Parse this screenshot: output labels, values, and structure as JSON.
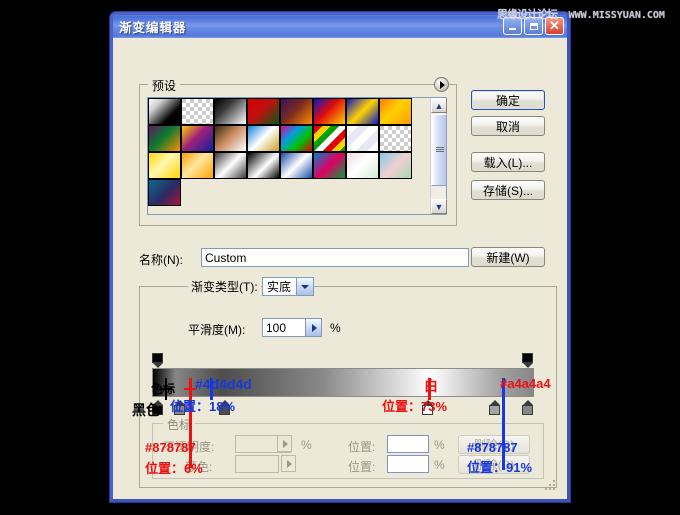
{
  "watermark": {
    "cn": "思缘设计论坛",
    "url": "WWW.MISSYUAN.COM"
  },
  "window": {
    "title": "渐变编辑器",
    "controls": {
      "minimize": "minimize-icon",
      "maximize": "maximize-icon",
      "close": "close-icon"
    }
  },
  "preset": {
    "legend": "预设",
    "arrow_icon": "preset-menu-arrow-icon",
    "scroll_up_icon": "▲",
    "scroll_down_icon": "▼",
    "swatches": [
      [
        "linear-gradient(135deg,#ffffff 0%,#cfcfcf 25%,#000000 70%)",
        "repeating-conic-gradient(#ffffff 0% 25%,#cccccc 0% 50%) 0 0/8px 8px",
        "linear-gradient(135deg,#000000 0%,#3a3a3a 35%,#ffffff 100%)",
        "linear-gradient(135deg,#d40000 0%,#c01010 45%,#0a5a14 100%)",
        "linear-gradient(135deg,#3b1060 0%,#7a2a20 45%,#ff8c00 100%)",
        "linear-gradient(135deg,#0b16c4 0%,#e00c0c 45%,#ffd000 100%)",
        "linear-gradient(135deg,#0b16c4 0%,#ffd400 50%,#0b16c4 100%)",
        "linear-gradient(135deg,#ff7a00 0%,#ffd000 45%,#ff9c00 100%)"
      ],
      [
        "linear-gradient(135deg,#6a1560 0%,#0a7a30 45%,#ff8c00 100%)",
        "linear-gradient(135deg,#ffd000 0%,#a0207a 45%,#1020a0 100%)",
        "linear-gradient(135deg,#3a2a10 0%,#c98a60 45%,#ffffff 100%)",
        "linear-gradient(135deg,#1080d8 0%,#ffffff 48%,#c8a020 100%)",
        "linear-gradient(135deg,#e000a0 0%,#00a0e0 35%,#00c000 65%,#e00000 100%)",
        "repeating-linear-gradient(135deg,#e00000 0 6px,#ffd000 6px 12px,#00a000 12px 18px,#ffffff 18px 24px)",
        "repeating-linear-gradient(135deg,#ffffff 0 8px,#e8e8f0 8px 16px)",
        "repeating-conic-gradient(#ffffff 0% 25%,#cccccc 0% 50%) 0 0/8px 8px"
      ],
      [
        "linear-gradient(135deg,#ffd800 0%,#fff7b0 45%,#ffd800 100%)",
        "linear-gradient(135deg,#ffa000 0%,#ffe8a0 45%,#ffa000 100%)",
        "linear-gradient(135deg,#3a3a3a 0%,#ffffff 50%,#3a3a3a 100%)",
        "linear-gradient(135deg,#000000 0%,#ffffff 55%,#000000 100%)",
        "linear-gradient(135deg,#1848a8 0%,#ffffff 50%,#1848a8 100%)",
        "linear-gradient(135deg,#0080d0 0%,#e00060 50%,#00a040 100%)",
        "linear-gradient(135deg,#f0d8e0 0%,#ffffff 45%,#d8ecd8 100%)",
        "linear-gradient(135deg,#80c8e8 0%,#f0d0d0 50%,#a8d8b0 100%)"
      ],
      [
        "linear-gradient(135deg,#0a6a90 0%,#2a2a60 55%,#b01040 100%)"
      ]
    ]
  },
  "buttons": {
    "ok": "确定",
    "cancel": "取消",
    "load": "载入(L)...",
    "save": "存储(S)...",
    "new": "新建(W)"
  },
  "name_field": {
    "label": "名称(N):",
    "value": "Custom"
  },
  "gradient_type": {
    "label": "渐变类型(T):",
    "value": "实底",
    "dropdown_icon": "chevron-down-icon"
  },
  "smoothness": {
    "label": "平滑度(M):",
    "value": "100",
    "unit": "%",
    "spin_icon": "spinner-arrow-icon"
  },
  "stop_controls": {
    "legend": "色标",
    "opacity_label": "不透明度:",
    "opacity_value": "",
    "opacity_unit": "%",
    "opacity_spin_icon": "spinner-arrow-icon",
    "position_label_1": "位置:",
    "position_value_1": "",
    "position_unit_1": "%",
    "delete_label_1": "删除(D)",
    "color_label": "颜色:",
    "color_value": "",
    "color_spin_icon": "spinner-arrow-icon",
    "position_label_2": "位置:",
    "position_value_2": "",
    "position_unit_2": "%",
    "delete_label_2": "删除(D)"
  },
  "gradient": {
    "bar_css": "linear-gradient(to right,#000000 0%,#878787 6%,#4d4d4d 18%,#8a8a8a 45%,#ffffff 73%,#a4a4a4 91%,#878787 100%)",
    "opacity_stops": [
      {
        "pos_pct": 0,
        "fill": "#000000"
      },
      {
        "pos_pct": 100,
        "fill": "#000000"
      }
    ],
    "color_stops": [
      {
        "pos_pct": 0,
        "fill": "#000000",
        "name": "黑色"
      },
      {
        "pos_pct": 6,
        "fill": "#878787"
      },
      {
        "pos_pct": 18,
        "fill": "#4d4d4d"
      },
      {
        "pos_pct": 73,
        "fill": "#ffffff",
        "name": "白"
      },
      {
        "pos_pct": 91,
        "fill": "#a4a4a4"
      },
      {
        "pos_pct": 100,
        "fill": "#878787"
      }
    ]
  },
  "annotations": [
    {
      "id": "a-sebiao",
      "text": "色标",
      "color": "#000000"
    },
    {
      "id": "a-heise",
      "text": "黑色",
      "color": "#000000"
    },
    {
      "id": "a-4d4d4d",
      "text": "#4d4d4d",
      "color": "#1838dd"
    },
    {
      "id": "a-pos18",
      "text": "位置：18%",
      "color": "#1838dd"
    },
    {
      "id": "a-bai",
      "text": "白",
      "color": "#ee1111"
    },
    {
      "id": "a-pos73",
      "text": "位置：73%",
      "color": "#ee1111"
    },
    {
      "id": "a-a4a4a4",
      "text": "#a4a4a4",
      "color": "#ee1111"
    },
    {
      "id": "a-878787a",
      "text": "#878787",
      "color": "#ee1111"
    },
    {
      "id": "a-pos6",
      "text": "位置：6%",
      "color": "#ee1111"
    },
    {
      "id": "a-878787b",
      "text": "#878787",
      "color": "#1838dd"
    },
    {
      "id": "a-pos91",
      "text": "位置：91%",
      "color": "#1838dd"
    }
  ]
}
